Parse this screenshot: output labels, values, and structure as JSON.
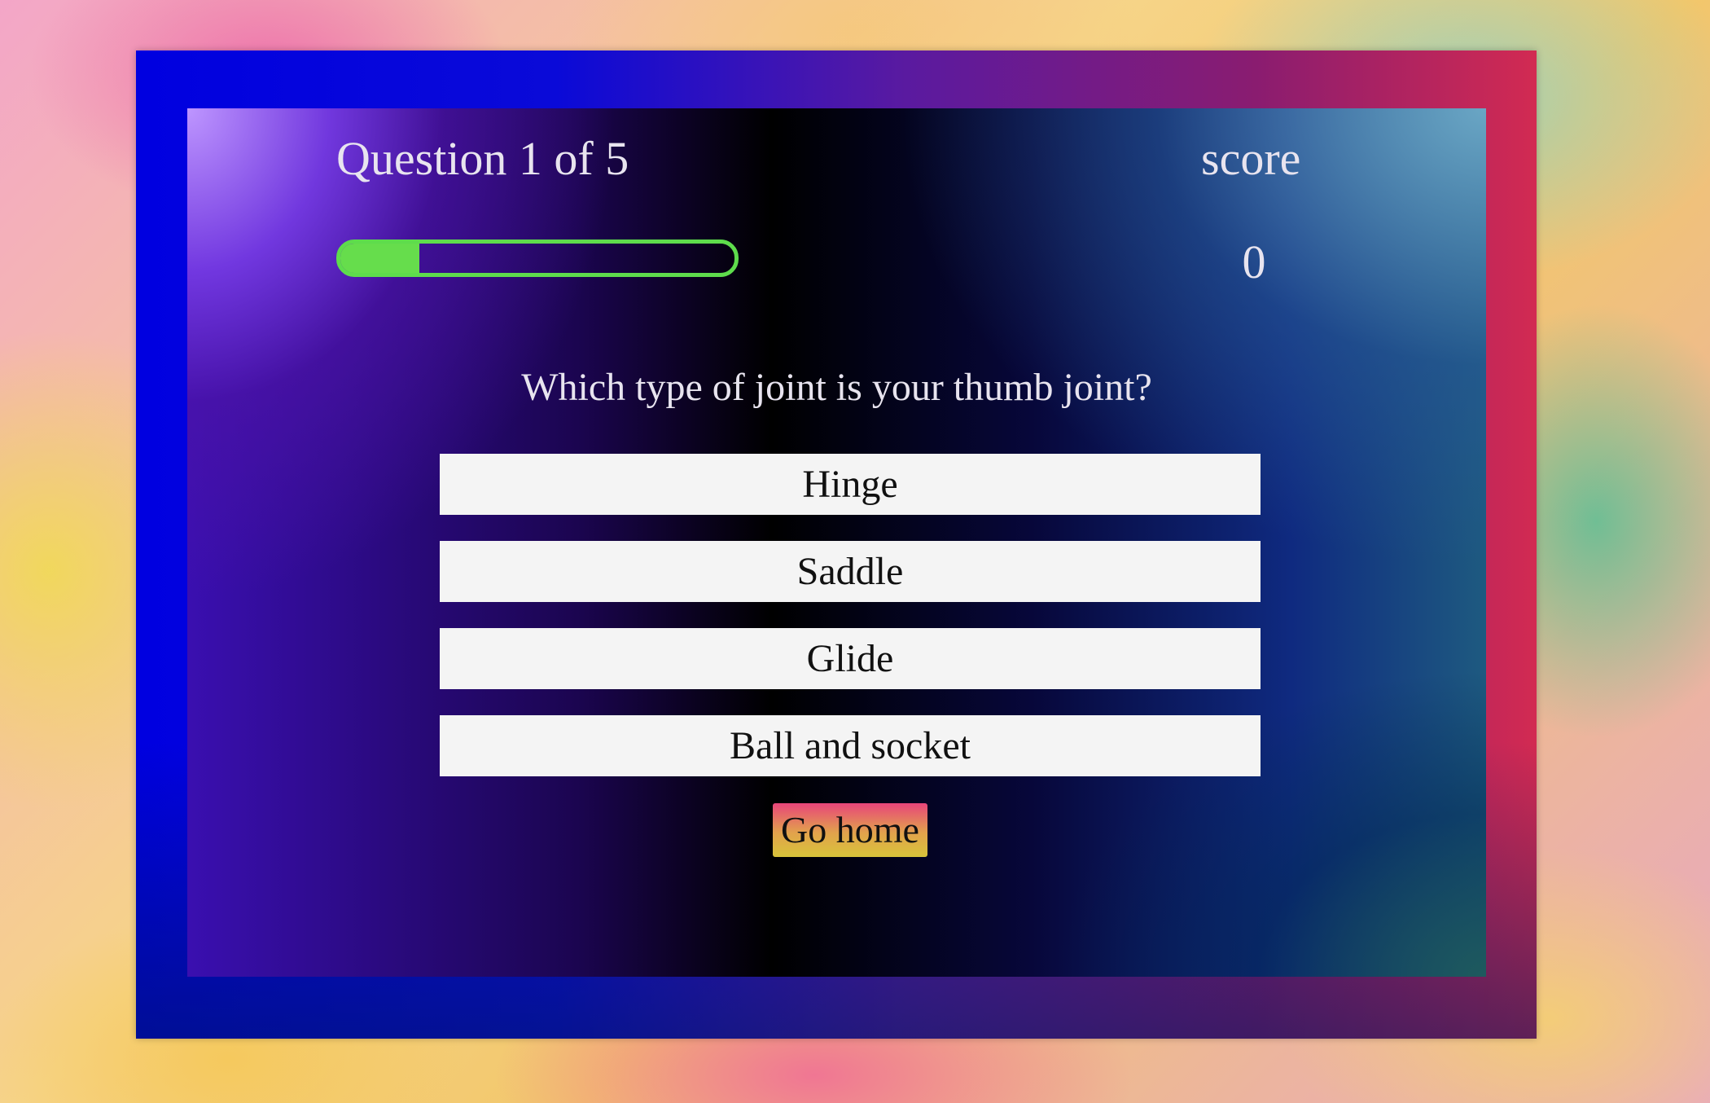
{
  "quiz": {
    "question_counter": "Question 1 of 5",
    "progress_fraction": 0.2,
    "score_label": "score",
    "score_value": "0",
    "question_text": "Which type of joint is your thumb joint?",
    "choices": [
      {
        "label": "Hinge"
      },
      {
        "label": "Saddle"
      },
      {
        "label": "Glide"
      },
      {
        "label": "Ball and socket"
      }
    ],
    "home_button_label": "Go home"
  },
  "colors": {
    "progress_accent": "#66dd4c",
    "choice_background": "#f4f4f4",
    "text_light": "#e8e4ef"
  }
}
